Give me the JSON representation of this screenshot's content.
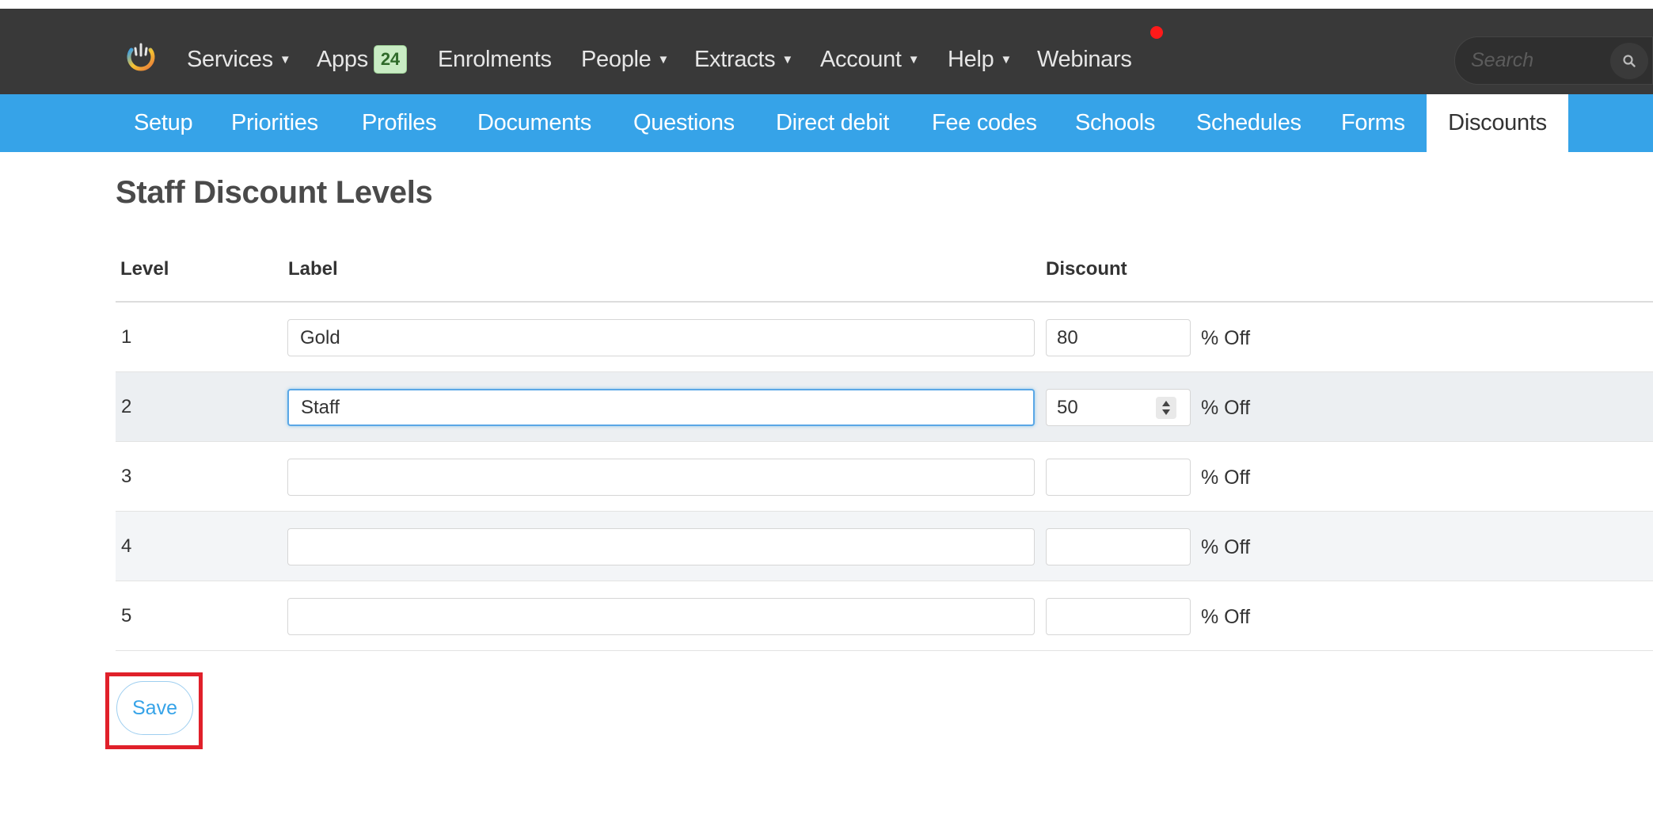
{
  "navbar": {
    "items": [
      {
        "label": "Services",
        "dropdown": true
      },
      {
        "label": "Apps",
        "badge": "24"
      },
      {
        "label": "Enrolments"
      },
      {
        "label": "People",
        "dropdown": true
      },
      {
        "label": "Extracts",
        "dropdown": true
      },
      {
        "label": "Account",
        "dropdown": true
      },
      {
        "label": "Help",
        "dropdown": true
      },
      {
        "label": "Webinars"
      }
    ],
    "search_placeholder": "Search",
    "caret": "▼"
  },
  "subnav": {
    "tabs": [
      {
        "label": "Setup"
      },
      {
        "label": "Priorities"
      },
      {
        "label": "Profiles"
      },
      {
        "label": "Documents"
      },
      {
        "label": "Questions"
      },
      {
        "label": "Direct debit"
      },
      {
        "label": "Fee codes"
      },
      {
        "label": "Schools"
      },
      {
        "label": "Schedules"
      },
      {
        "label": "Forms"
      },
      {
        "label": "Discounts",
        "active": true
      }
    ]
  },
  "page": {
    "title": "Staff Discount Levels"
  },
  "table": {
    "headers": {
      "level": "Level",
      "label": "Label",
      "discount": "Discount"
    },
    "suffix": "% Off",
    "rows": [
      {
        "level": "1",
        "label": "Gold",
        "discount": "80"
      },
      {
        "level": "2",
        "label": "Staff",
        "discount": "50"
      },
      {
        "level": "3",
        "label": "",
        "discount": ""
      },
      {
        "level": "4",
        "label": "",
        "discount": ""
      },
      {
        "level": "5",
        "label": "",
        "discount": ""
      }
    ]
  },
  "actions": {
    "save_label": "Save"
  },
  "colors": {
    "navbar_bg": "#393939",
    "subnav_bg": "#36a3e8",
    "highlight": "#e0202a",
    "notification": "#ff1a1a"
  }
}
